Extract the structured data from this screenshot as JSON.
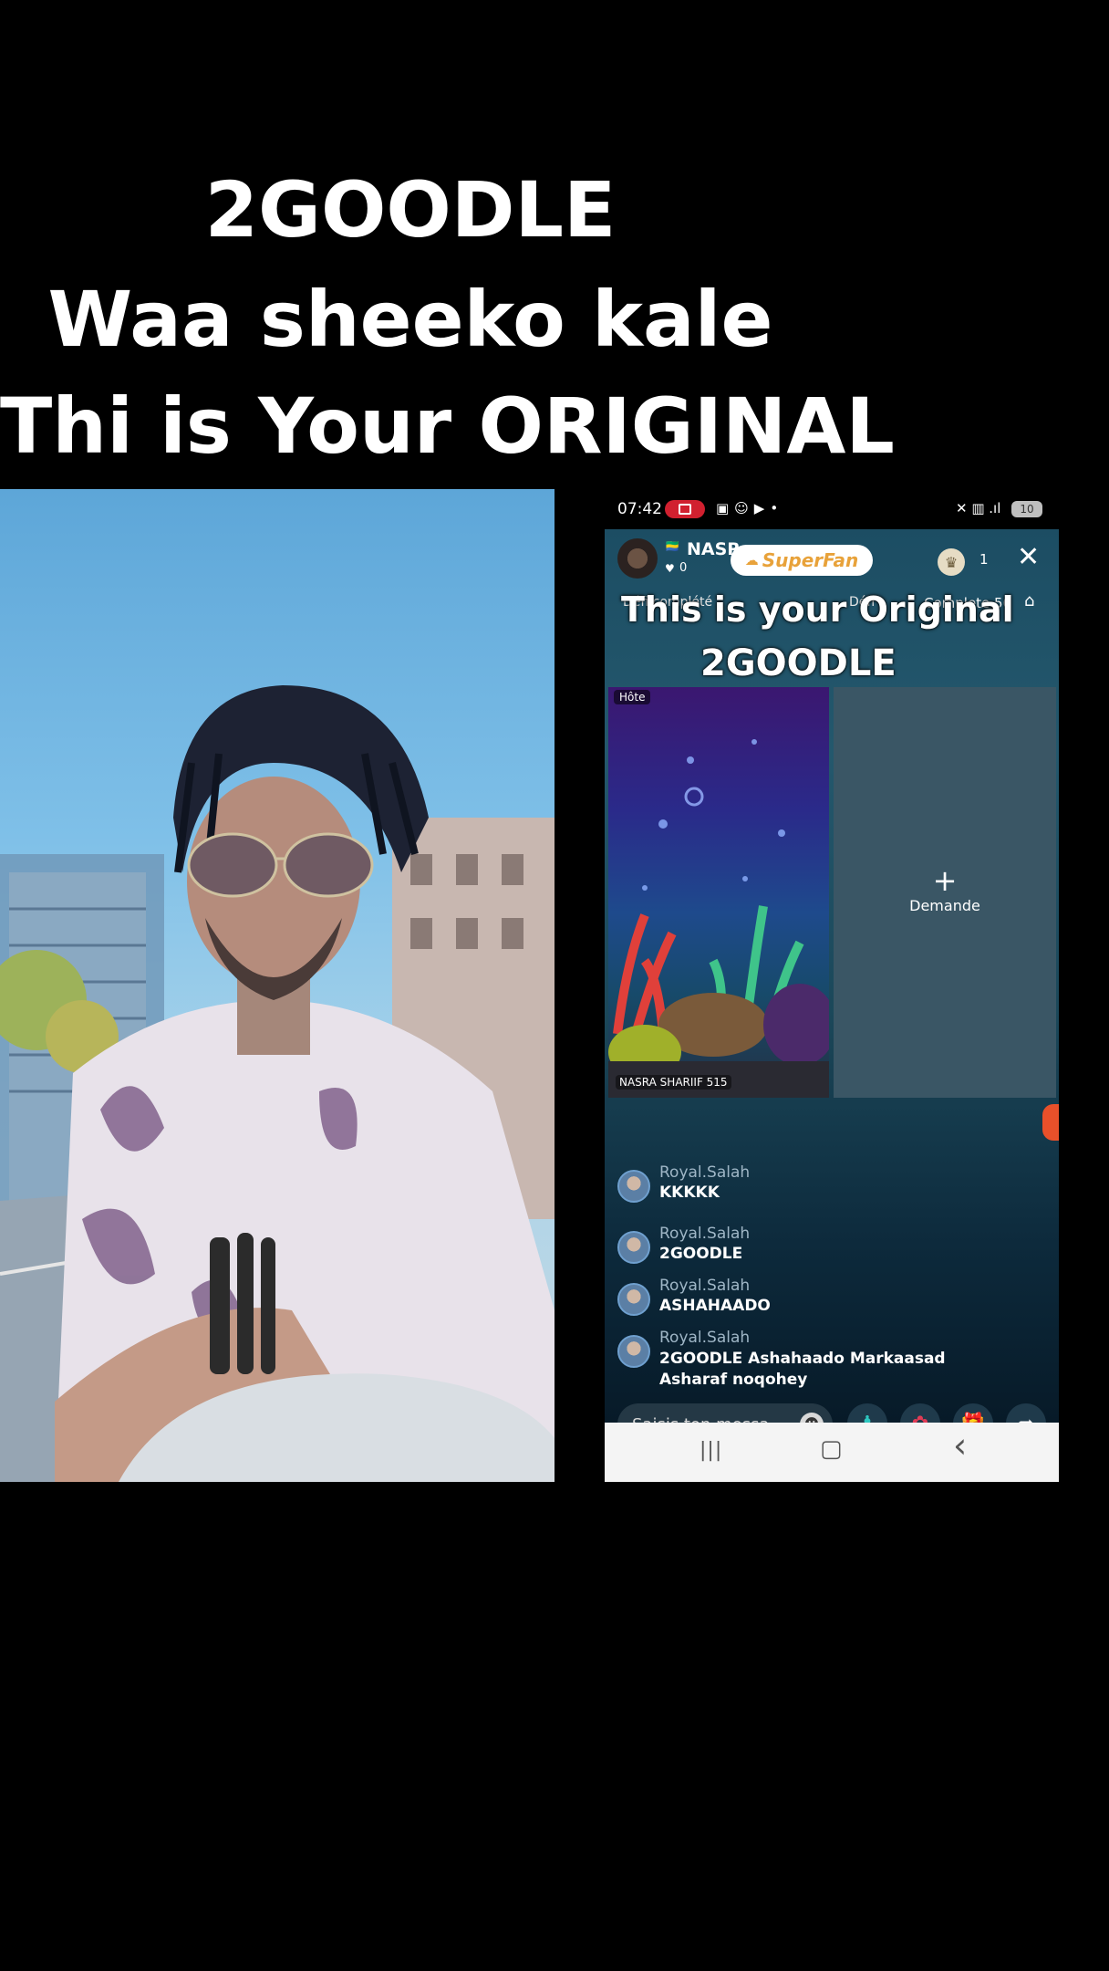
{
  "caption": {
    "line1": "2GOODLE",
    "line2": "Waa sheeko kale",
    "line3": "Thi is Your ORIGINAL"
  },
  "phone": {
    "status": {
      "time": "07:42",
      "battery": "10"
    },
    "header": {
      "host_name": "NASR",
      "likes": "0",
      "superfan_label": "SuperFan",
      "viewer_count": "1",
      "ticker_left": "Défi complété",
      "ticker_mid": "Défi",
      "ticker_right": "Complete 50"
    },
    "overlay": {
      "line1": "This is your Original",
      "line2": "2GOODLE"
    },
    "host_tile": {
      "badge": "Hôte",
      "name": "NASRA SHARIIF 515"
    },
    "guest_tile": {
      "plus": "+",
      "label": "Demande"
    },
    "chat": [
      {
        "user": "Royal.Salah",
        "message": "KKKKK"
      },
      {
        "user": "Royal.Salah",
        "message": "2GOODLE"
      },
      {
        "user": "Royal.Salah",
        "message": "ASHAHAADO"
      },
      {
        "user": "Royal.Salah",
        "message": "2GOODLE Ashahaado Markaasad Asharaf noqohey"
      }
    ],
    "input_placeholder": "Saisis ton messa...",
    "nav": {
      "recents": "|||",
      "home": "▢",
      "back": "‹"
    }
  },
  "colors": {
    "superfan_text": "#e8a23a",
    "record_badge": "#d1202f",
    "gift_icon": "#e0356b",
    "rose_icon": "#e23b55"
  }
}
